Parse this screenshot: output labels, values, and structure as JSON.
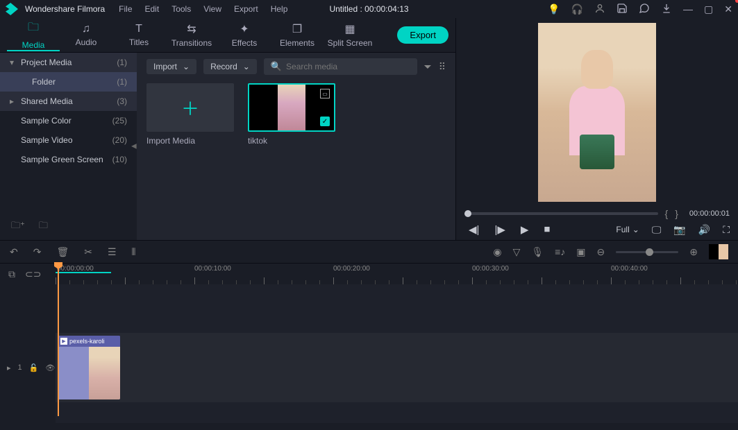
{
  "app": {
    "name": "Wondershare Filmora"
  },
  "menu": [
    "File",
    "Edit",
    "Tools",
    "View",
    "Export",
    "Help"
  ],
  "title": "Untitled : 00:00:04:13",
  "tabs": [
    {
      "label": "Media",
      "icon": "folder"
    },
    {
      "label": "Audio",
      "icon": "music"
    },
    {
      "label": "Titles",
      "icon": "text"
    },
    {
      "label": "Transitions",
      "icon": "transition"
    },
    {
      "label": "Effects",
      "icon": "effects"
    },
    {
      "label": "Elements",
      "icon": "elements"
    },
    {
      "label": "Split Screen",
      "icon": "split"
    }
  ],
  "export_label": "Export",
  "sidebar": {
    "items": [
      {
        "label": "Project Media",
        "count": "(1)",
        "arrow": "▾",
        "head": true
      },
      {
        "label": "Folder",
        "count": "(1)",
        "sel": true
      },
      {
        "label": "Shared Media",
        "count": "(3)",
        "arrow": "▸",
        "head": true
      },
      {
        "label": "Sample Color",
        "count": "(25)"
      },
      {
        "label": "Sample Video",
        "count": "(20)"
      },
      {
        "label": "Sample Green Screen",
        "count": "(10)"
      }
    ]
  },
  "media_toolbar": {
    "import": "Import",
    "record": "Record",
    "search_placeholder": "Search media"
  },
  "media_tiles": {
    "import": "Import Media",
    "clip1": "tiktok"
  },
  "preview": {
    "timecode": "00:00:00:01",
    "marker_in": "{",
    "marker_out": "}",
    "full": "Full"
  },
  "ruler": {
    "t0": "00:00:00:00",
    "t1": "00:00:10:00",
    "t2": "00:00:20:00",
    "t3": "00:00:30:00",
    "t4": "00:00:40:00"
  },
  "track": {
    "id": "1",
    "clip_name": "pexels-karoli"
  }
}
